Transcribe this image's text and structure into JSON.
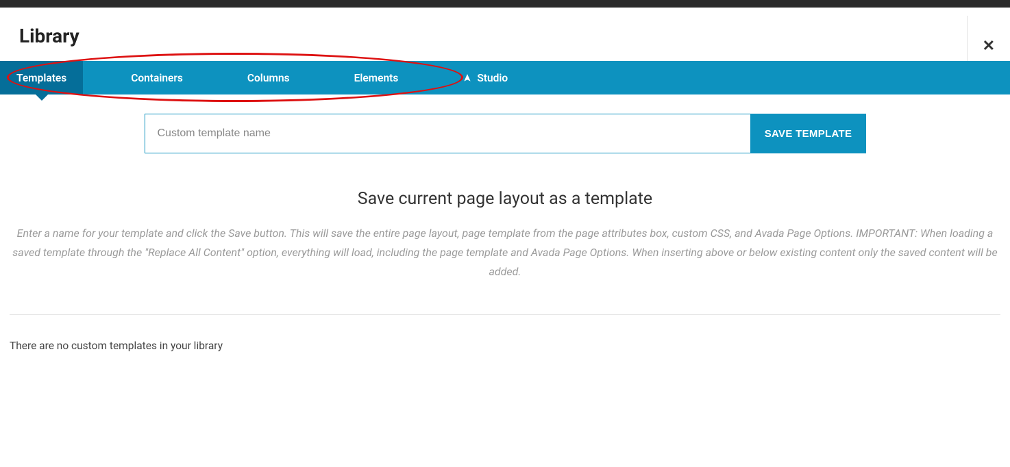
{
  "header": {
    "title": "Library"
  },
  "nav": {
    "tabs": [
      {
        "label": "Templates"
      },
      {
        "label": "Containers"
      },
      {
        "label": "Columns"
      },
      {
        "label": "Elements"
      },
      {
        "label": "Studio"
      }
    ]
  },
  "template_form": {
    "placeholder": "Custom template name",
    "save_button": "Save Template"
  },
  "section": {
    "heading": "Save current page layout as a template",
    "description": "Enter a name for your template and click the Save button. This will save the entire page layout, page template from the page attributes box, custom CSS, and Avada Page Options. IMPORTANT: When loading a saved template through the \"Replace All Content\" option, everything will load, including the page template and Avada Page Options. When inserting above or below existing content only the saved content will be added."
  },
  "library": {
    "empty_message": "There are no custom templates in your library"
  },
  "colors": {
    "brand": "#0d92bf",
    "brand_dark": "#056e99"
  }
}
